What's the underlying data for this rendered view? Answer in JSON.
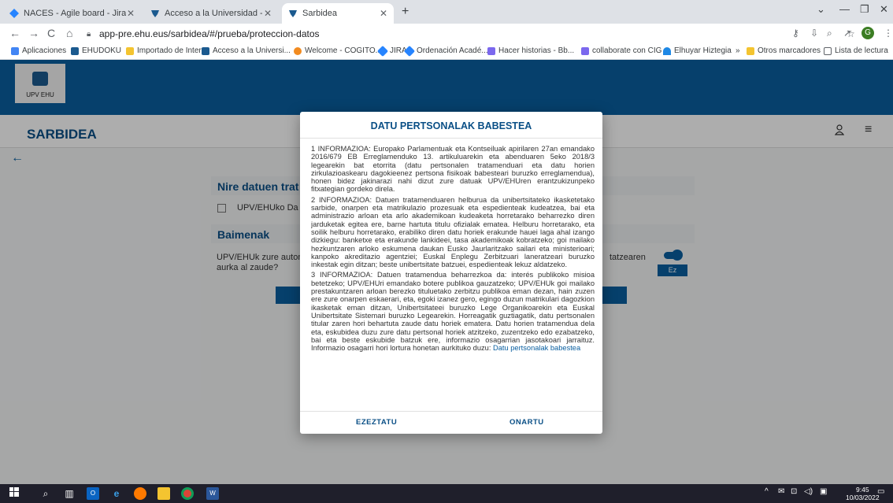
{
  "browser": {
    "tabs": [
      {
        "title": "NACES - Agile board - Jira",
        "icon": "jira-icon",
        "color": "#2684ff"
      },
      {
        "title": "Acceso a la Universidad - UPV/EH",
        "icon": "upv-ehu-icon",
        "color": "#1b5a8f"
      },
      {
        "title": "Sarbidea",
        "icon": "upv-ehu-icon",
        "color": "#1b5a8f"
      }
    ],
    "new_tab": "+",
    "url": "app-pre.ehu.eus/sarbidea/#/prueba/proteccion-datos",
    "bookmarks": [
      {
        "label": "Aplicaciones",
        "color": "#4285f4"
      },
      {
        "label": "EHUDOKU",
        "color": "#1b5a8f"
      },
      {
        "label": "Importado de Inter...",
        "color": "#f4c430"
      },
      {
        "label": "Acceso a la Universi...",
        "color": "#1b5a8f"
      },
      {
        "label": "Welcome - COGITO...",
        "color": "#f28b20"
      },
      {
        "label": "JIRA",
        "color": "#2684ff"
      },
      {
        "label": "Ordenación Acadé...",
        "color": "#2684ff"
      },
      {
        "label": "Hacer historias - Bb...",
        "color": "#7b68ee"
      },
      {
        "label": "collaborate con CIG",
        "color": "#7b68ee"
      },
      {
        "label": "Elhuyar Hiztegia",
        "color": "#1e88e5"
      },
      {
        "label": "»",
        "color": ""
      },
      {
        "label": "Otros marcadores",
        "color": "#f4c430"
      },
      {
        "label": "Lista de lectura",
        "color": "#5f6368"
      }
    ],
    "profile_initial": "G"
  },
  "site": {
    "logo_text": "UPV EHU",
    "app_title": "SARBIDEA",
    "section1_heading": "Nire datuen trat",
    "checkbox_label": "UPV/EHUko Da",
    "section2_heading": "Baimenak",
    "permission_text": "UPV/EHUk zure auton aurka al zaude?",
    "permission_text_right": "tatzearen",
    "toggle_badge": "Ez"
  },
  "modal": {
    "title": "DATU PERTSONALAK BABESTEA",
    "paragraphs": [
      "1 INFORMAZIOA: Europako Parlamentuak eta Kontseiluak apirilaren 27an emandako 2016/679 EB Erreglamenduko 13. artikuluarekin eta abenduaren 5eko 2018/3 legearekin bat etorrita (datu pertsonalen tratamenduari eta datu horien zirkulazioaskearu dagokieenez pertsona fisikoak babesteari buruzko erreglamendua), honen bidez jakinarazi nahi dizut zure datuak UPV/EHUren erantzukizunpeko fitxategian gordeko direla.",
      "2 INFORMAZIOA: Datuen tratamenduaren helburua da unibertsitateko ikasketetako sarbide, onarpen eta matrikulazio prozesuak eta espedienteak kudeatzea, bai eta administrazio arloan eta arlo akademikoan kudeaketa horretarako beharrezko diren jarduketak egitea ere, barne hartuta titulu ofizialak ematea. Helburu horretarako, eta soilik helburu horretarako, erabiliko diren datu horiek erakunde hauei laga ahal izango dizkiegu: banketxe eta erakunde lankideei, tasa akademikoak kobratzeko; goi mailako hezkuntzaren arloko eskumena daukan Eusko Jaurlaritzako sailari eta ministerioari; kanpoko akreditazio agentziei; Euskal Enplegu Zerbitzuari laneratzeari buruzko inkestak egin ditzan; beste unibertsitate batzuei, espedienteak lekuz aldatzeko.",
      "3 INFORMAZIOA: Datuen tratamendua beharrezkoa da: interés publikoko misioa betetzeko; UPV/EHUri emandako botere publikoa gauzatzeko; UPV/EHUk goi mailako prestakuntzaren arloan berezko tituluetako zerbitzu publikoa eman dezan, hain zuzen ere zure onarpen eskaerari, eta, egoki izanez gero, egingo duzun matrikulari dagozkion ikasketak eman ditzan, Unibertsitateei buruzko Lege Organikoarekin eta Euskal Unibertsitate Sistemari buruzko Legearekin. Horreagatik guztiagatik, datu pertsonalen titular zaren hori behartuta zaude datu horiek ematera. Datu horien tratamendua dela eta, eskubidea duzu zure datu pertsonal horiek atzitzeko, zuzentzeko edo ezabatzeko, bai eta beste eskubide batzuk ere, informazio osagarrian jasotakoari jarraituz. Informazio osagarri hori lortura honetan aurkituko duzu:"
    ],
    "link_text": "Datu pertsonalak babestea",
    "reject_label": "EZEZTATU",
    "accept_label": "ONARTU"
  },
  "taskbar": {
    "time": "9:45",
    "date": "10/03/2022"
  }
}
